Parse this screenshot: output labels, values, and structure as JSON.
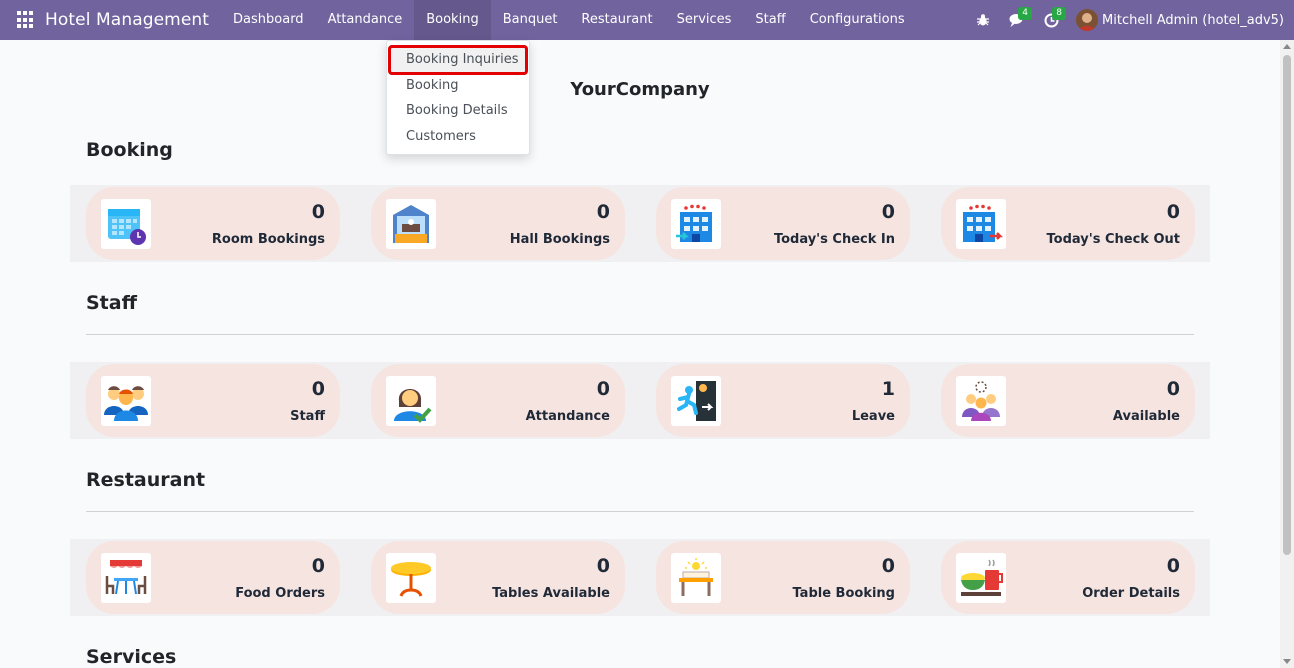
{
  "navbar": {
    "brand": "Hotel Management",
    "menu": [
      "Dashboard",
      "Attandance",
      "Booking",
      "Banquet",
      "Restaurant",
      "Services",
      "Staff",
      "Configurations"
    ],
    "active_menu": "Booking",
    "chat_count": "4",
    "activity_count": "8",
    "user": "Mitchell Admin (hotel_adv5)",
    "color": "#71639e"
  },
  "dropdown": {
    "items": [
      "Booking Inquiries",
      "Booking",
      "Booking Details",
      "Customers"
    ],
    "highlighted": "Booking Inquiries",
    "highlight_color": "#e30000"
  },
  "company": "YourCompany",
  "sections": [
    {
      "title": "Booking",
      "cards": [
        {
          "value": "0",
          "label": "Room Bookings",
          "icon": "calendar-icon"
        },
        {
          "value": "0",
          "label": "Hall Bookings",
          "icon": "hall-icon"
        },
        {
          "value": "0",
          "label": "Today's Check In",
          "icon": "hotel-checkin-icon"
        },
        {
          "value": "0",
          "label": "Today's Check Out",
          "icon": "hotel-checkout-icon"
        }
      ]
    },
    {
      "title": "Staff",
      "cards": [
        {
          "value": "0",
          "label": "Staff",
          "icon": "staff-group-icon"
        },
        {
          "value": "0",
          "label": "Attandance",
          "icon": "attendance-icon"
        },
        {
          "value": "1",
          "label": "Leave",
          "icon": "exit-icon"
        },
        {
          "value": "0",
          "label": "Available",
          "icon": "available-staff-icon"
        }
      ]
    },
    {
      "title": "Restaurant",
      "cards": [
        {
          "value": "0",
          "label": "Food Orders",
          "icon": "dining-icon"
        },
        {
          "value": "0",
          "label": "Tables Available",
          "icon": "table-icon"
        },
        {
          "value": "0",
          "label": "Table Booking",
          "icon": "table-booking-icon"
        },
        {
          "value": "0",
          "label": "Order Details",
          "icon": "food-order-icon"
        }
      ]
    },
    {
      "title": "Services",
      "cards": []
    }
  ],
  "card_color": "#f6e4e0"
}
